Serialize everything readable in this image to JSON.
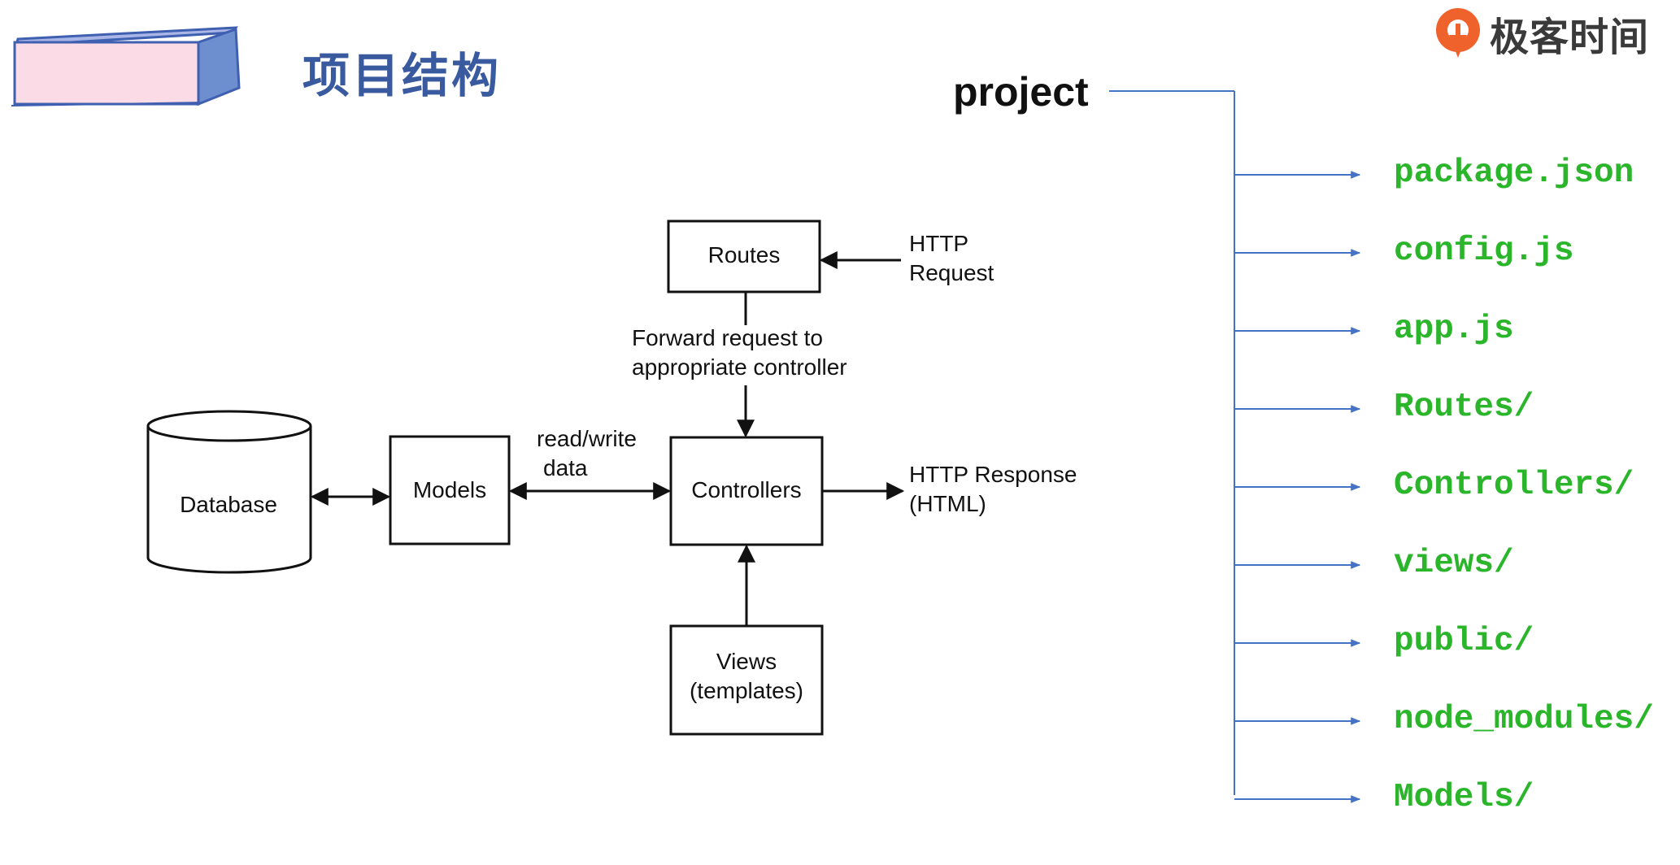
{
  "slide": {
    "title": "项目结构",
    "brand": "极客时间",
    "accent_color": "#3a5aa0",
    "icons": {
      "brand_logo": "geektime-logo-icon",
      "header_decoration": "box-decoration"
    }
  },
  "architecture_diagram": {
    "nodes": {
      "routes": "Routes",
      "controllers": "Controllers",
      "models": "Models",
      "views": [
        "Views",
        "(templates)"
      ],
      "database": "Database"
    },
    "labels": {
      "http_request": [
        "HTTP",
        "Request"
      ],
      "forward_request": [
        "Forward request to",
        "appropriate controller"
      ],
      "read_write": [
        "read/write",
        "data"
      ],
      "http_response": [
        "HTTP Response",
        "(HTML)"
      ]
    }
  },
  "project_tree": {
    "root": "project",
    "line_color": "#4472c4",
    "item_color": "#2bb52b",
    "items": [
      "package.json",
      "config.js",
      "app.js",
      "Routes/",
      "Controllers/",
      "views/",
      "public/",
      "node_modules/",
      "Models/"
    ]
  }
}
